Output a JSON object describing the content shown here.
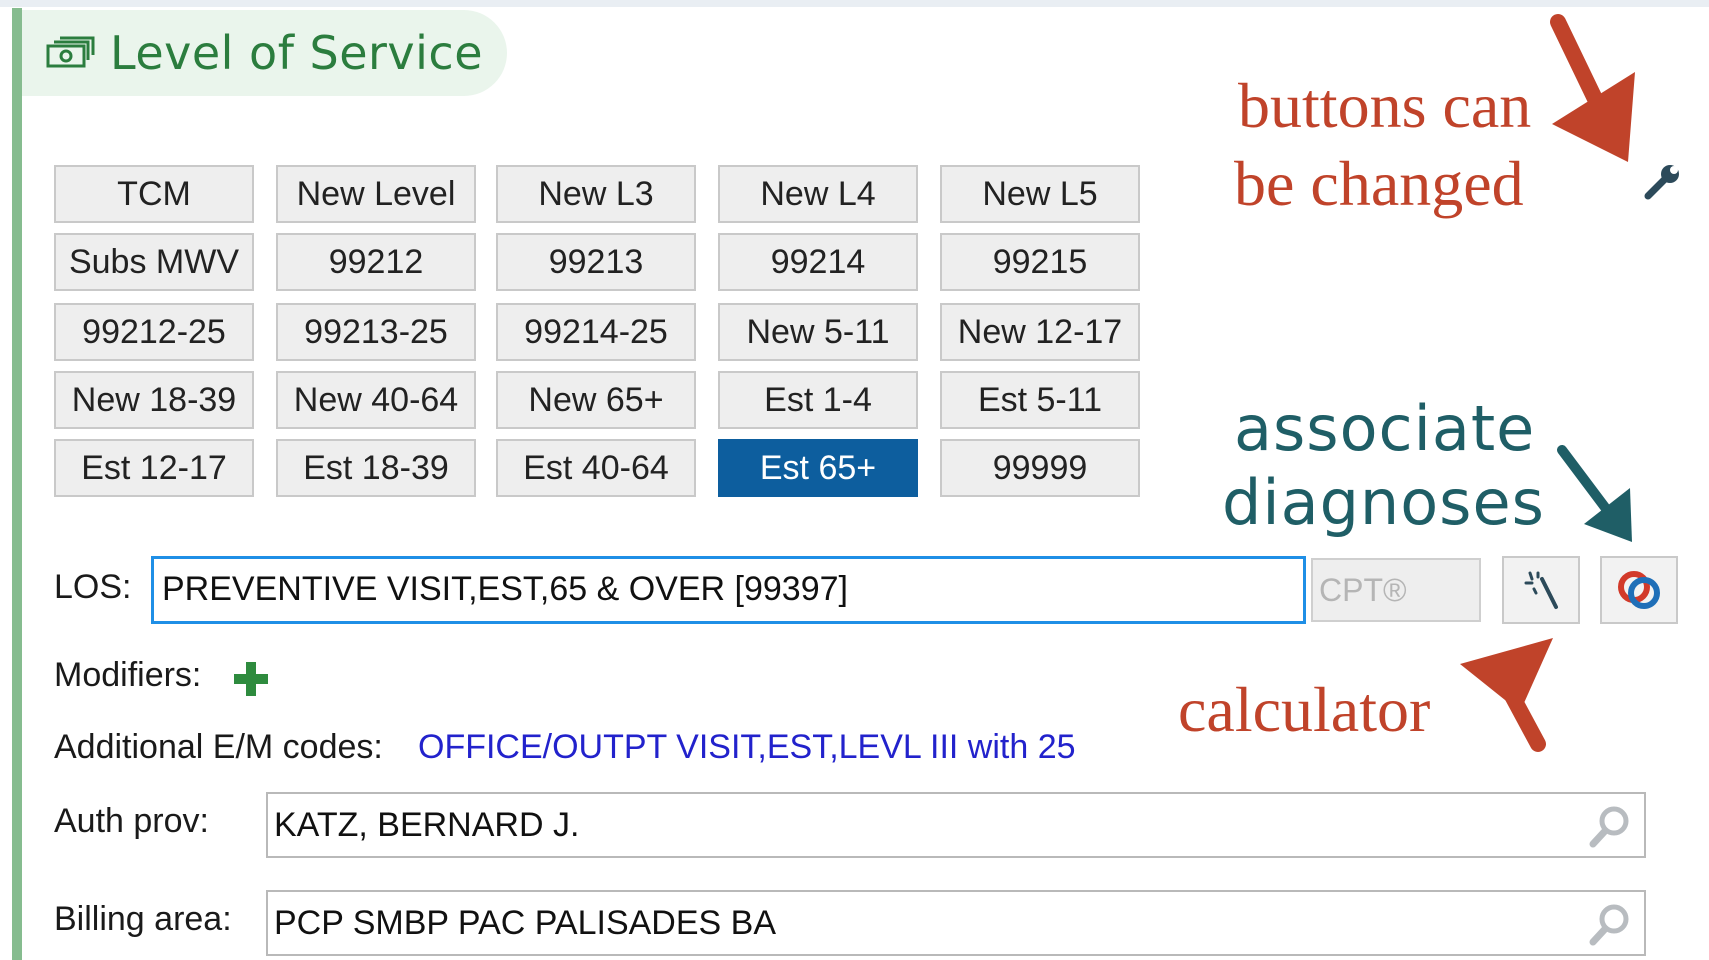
{
  "section": {
    "title": "Level of Service",
    "icon": "money-icon"
  },
  "los_buttons": [
    [
      "TCM",
      "New Level",
      "New L3",
      "New L4",
      "New L5"
    ],
    [
      "Subs MWV",
      "99212",
      "99213",
      "99214",
      "99215"
    ],
    [
      "99212-25",
      "99213-25",
      "99214-25",
      "New 5-11",
      "New 12-17"
    ],
    [
      "New 18-39",
      "New 40-64",
      "New 65+",
      "Est 1-4",
      "Est 5-11"
    ],
    [
      "Est 12-17",
      "Est 18-39",
      "Est 40-64",
      "Est 65+",
      "99999"
    ]
  ],
  "selected_button": "Est 65+",
  "annotations": {
    "buttons_changed_line1": "buttons can",
    "buttons_changed_line2": "be changed",
    "associate_line1": "associate",
    "associate_line2": "diagnoses",
    "calculator": "calculator"
  },
  "los": {
    "label": "LOS:",
    "value": "PREVENTIVE VISIT,EST,65 & OVER [99397]",
    "cpt_placeholder": "CPT®"
  },
  "modifiers": {
    "label": "Modifiers:"
  },
  "additional_em": {
    "label": "Additional E/M codes:",
    "link": "OFFICE/OUTPT VISIT,EST,LEVL III with 25"
  },
  "auth_prov": {
    "label": "Auth prov:",
    "value": "KATZ, BERNARD J."
  },
  "billing_area": {
    "label": "Billing area:",
    "value": "PCP SMBP PAC PALISADES BA"
  },
  "colors": {
    "accent_green": "#2b7d3e",
    "selected_blue": "#0d5e9e",
    "focus_blue": "#1f8fe6",
    "link_blue": "#2222cc",
    "annotation_red": "#c0432a",
    "annotation_teal": "#1f5e66"
  }
}
